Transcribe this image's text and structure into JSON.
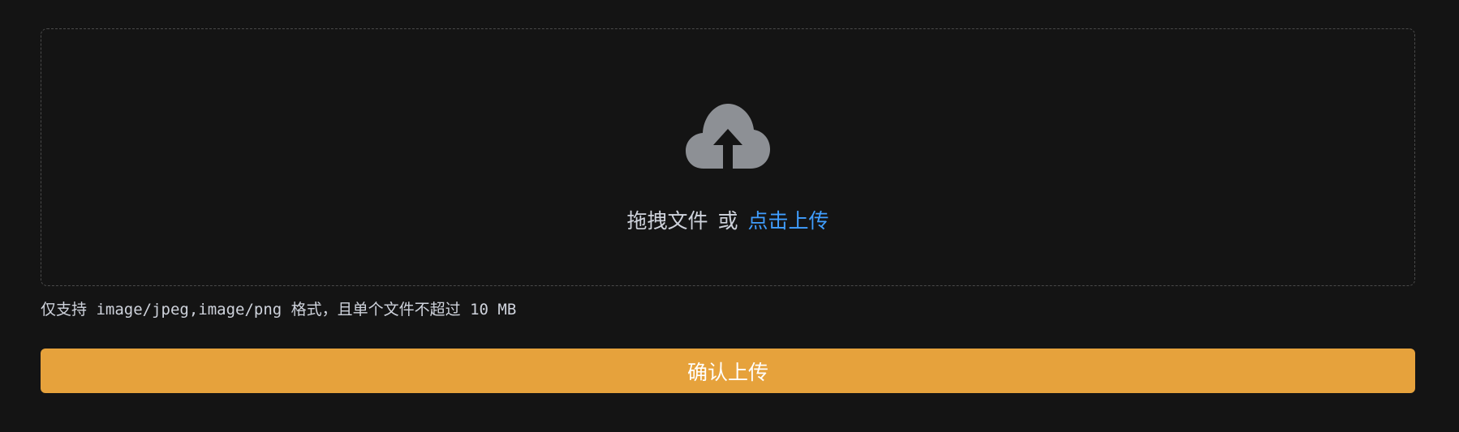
{
  "upload": {
    "drag_text": "拖拽文件",
    "or_text": "或",
    "click_text": "点击上传",
    "icon": "upload-cloud-icon",
    "tip": "仅支持 image/jpeg,image/png 格式，且单个文件不超过 10 MB"
  },
  "confirm_button": {
    "label": "确认上传"
  },
  "colors": {
    "background": "#141414",
    "icon": "#8d9095",
    "link": "#409eff",
    "button": "#e6a23c",
    "text": "#cfd3dc"
  }
}
